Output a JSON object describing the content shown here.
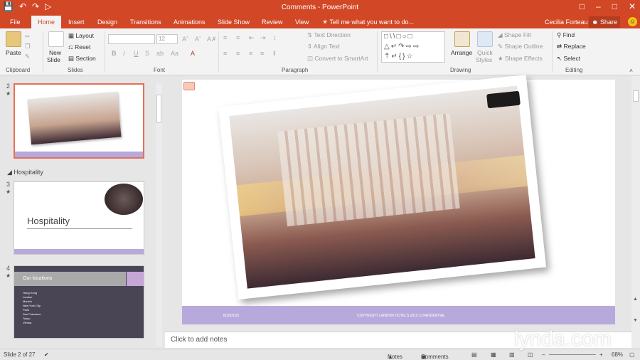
{
  "app": {
    "title": "Comments - PowerPoint"
  },
  "qat": {
    "save_icon": "save-icon",
    "undo_icon": "undo-icon",
    "redo_icon": "redo-icon",
    "present_icon": "present-icon"
  },
  "tabs": [
    "File",
    "Home",
    "Insert",
    "Design",
    "Transitions",
    "Animations",
    "Slide Show",
    "Review",
    "View"
  ],
  "active_tab": "Home",
  "tell_me": "Tell me what you want to do...",
  "user": "Cecilia Forteau",
  "share": "Share",
  "ribbon": {
    "clipboard": {
      "paste": "Paste",
      "label": "Clipboard"
    },
    "slides": {
      "new_slide": "New",
      "new_slide2": "Slide",
      "layout": "Layout",
      "reset": "Reset",
      "section": "Section",
      "label": "Slides"
    },
    "font": {
      "size": "12",
      "label": "Font",
      "bold": "B",
      "italic": "I",
      "underline": "U",
      "strike": "S"
    },
    "paragraph": {
      "text_direction": "Text Direction",
      "align_text": "Align Text",
      "smartart": "Convert to SmartArt",
      "label": "Paragraph"
    },
    "drawing": {
      "arrange": "Arrange",
      "quick_styles": "Quick",
      "quick_styles2": "Styles",
      "shape_fill": "Shape Fill",
      "shape_outline": "Shape Outline",
      "shape_effects": "Shape Effects",
      "label": "Drawing"
    },
    "editing": {
      "find": "Find",
      "replace": "Replace",
      "select": "Select",
      "label": "Editing"
    }
  },
  "thumbnails": [
    {
      "num": "2",
      "title": ""
    },
    {
      "num": "3",
      "title": "Hospitality"
    },
    {
      "num": "4",
      "title": "Our locations",
      "items": [
        "Hong Kong",
        "London",
        "Munich",
        "New York City",
        "Paris",
        "San Francisco",
        "Tokyo",
        "Vienna"
      ]
    }
  ],
  "section_name": "Hospitality",
  "slide": {
    "footer_date": "8/16/2015",
    "footer_text": "COPYRIGHT LANDON HOTELS 2015 CONFIDENTIAL"
  },
  "notes_placeholder": "Click to add notes",
  "status": {
    "slide_info": "Slide 2 of 27",
    "notes": "Notes",
    "comments": "Comments",
    "zoom": "68%"
  },
  "watermark": "lynda.com"
}
